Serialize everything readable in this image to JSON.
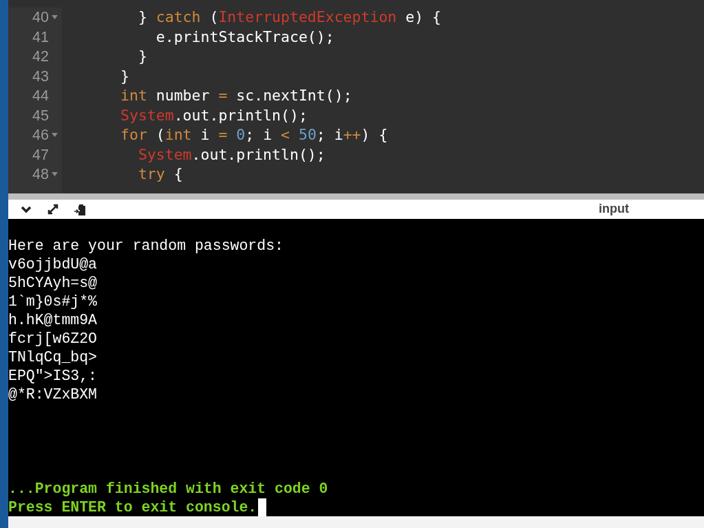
{
  "editor": {
    "lines": [
      {
        "number": "40",
        "foldable": true,
        "tokens": [
          {
            "kind": "plain",
            "text": "  } "
          },
          {
            "kind": "keyword",
            "text": "catch"
          },
          {
            "kind": "plain",
            "text": " ("
          },
          {
            "kind": "type",
            "text": "InterruptedException"
          },
          {
            "kind": "plain",
            "text": " e) {"
          }
        ]
      },
      {
        "number": "41",
        "foldable": false,
        "tokens": [
          {
            "kind": "plain",
            "text": "    e.printStackTrace();"
          }
        ]
      },
      {
        "number": "42",
        "foldable": false,
        "tokens": [
          {
            "kind": "plain",
            "text": "  }"
          }
        ]
      },
      {
        "number": "43",
        "foldable": false,
        "tokens": [
          {
            "kind": "plain",
            "text": "}"
          }
        ]
      },
      {
        "number": "44",
        "foldable": false,
        "tokens": [
          {
            "kind": "keyword",
            "text": "int"
          },
          {
            "kind": "plain",
            "text": " number "
          },
          {
            "kind": "operator",
            "text": "="
          },
          {
            "kind": "plain",
            "text": " sc.nextInt();"
          }
        ]
      },
      {
        "number": "45",
        "foldable": false,
        "tokens": [
          {
            "kind": "type",
            "text": "System"
          },
          {
            "kind": "plain",
            "text": ".out.println();"
          }
        ]
      },
      {
        "number": "46",
        "foldable": true,
        "tokens": [
          {
            "kind": "keyword",
            "text": "for"
          },
          {
            "kind": "plain",
            "text": " ("
          },
          {
            "kind": "keyword",
            "text": "int"
          },
          {
            "kind": "plain",
            "text": " i "
          },
          {
            "kind": "operator",
            "text": "= "
          },
          {
            "kind": "number",
            "text": "0"
          },
          {
            "kind": "plain",
            "text": "; i "
          },
          {
            "kind": "operator",
            "text": "< "
          },
          {
            "kind": "number",
            "text": "50"
          },
          {
            "kind": "plain",
            "text": "; i"
          },
          {
            "kind": "operator",
            "text": "++"
          },
          {
            "kind": "plain",
            "text": ") {"
          }
        ]
      },
      {
        "number": "47",
        "foldable": false,
        "tokens": [
          {
            "kind": "type",
            "text": "  System"
          },
          {
            "kind": "plain",
            "text": ".out.println();"
          }
        ]
      },
      {
        "number": "48",
        "foldable": true,
        "tokens": [
          {
            "kind": "keyword",
            "text": "  try"
          },
          {
            "kind": "plain",
            "text": " {"
          }
        ]
      }
    ]
  },
  "console_toolbar": {
    "label": "input"
  },
  "console": {
    "output": [
      "Here are your random passwords:",
      "v6ojjbdU@a",
      "5hCYAyh=s@",
      "1`m}0s#j*%",
      "h.hK@tmm9A",
      "fcrj[w6Z2O",
      "TNlqCq_bq>",
      "EPQ\">IS3,:",
      "@*R:VZxBXM"
    ],
    "status": [
      "...Program finished with exit code 0",
      "Press ENTER to exit console."
    ]
  }
}
